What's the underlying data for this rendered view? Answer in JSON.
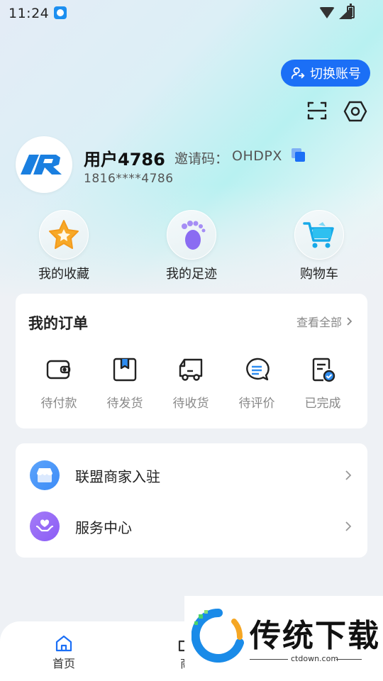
{
  "status_bar": {
    "time": "11:24"
  },
  "header": {
    "switch_account_label": "切换账号",
    "username": "用户4786",
    "invite_label": "邀请码：",
    "invite_code": "OHDPX",
    "phone": "1816****4786"
  },
  "quick_links": [
    {
      "label": "我的收藏",
      "icon": "star-icon"
    },
    {
      "label": "我的足迹",
      "icon": "footprint-icon"
    },
    {
      "label": "购物车",
      "icon": "cart-icon"
    }
  ],
  "orders": {
    "title": "我的订单",
    "view_all": "查看全部",
    "items": [
      {
        "label": "待付款",
        "icon": "wallet-icon"
      },
      {
        "label": "待发货",
        "icon": "package-icon"
      },
      {
        "label": "待收货",
        "icon": "truck-icon"
      },
      {
        "label": "待评价",
        "icon": "comment-icon"
      },
      {
        "label": "已完成",
        "icon": "completed-icon"
      }
    ]
  },
  "menu": [
    {
      "label": "联盟商家入驻",
      "icon": "store-icon",
      "color": "#3d8cf7"
    },
    {
      "label": "服务中心",
      "icon": "service-heart-icon",
      "color": "#8b5cf6"
    }
  ],
  "bottom_nav": [
    {
      "label": "首页",
      "icon": "home-icon"
    },
    {
      "label": "商",
      "icon": "shop-icon"
    }
  ],
  "watermark": {
    "title": "传统下载",
    "url": "ctdown.com"
  },
  "colors": {
    "accent": "#1b6ff6",
    "card_bg": "#ffffff",
    "page_bg": "#eef1f5"
  }
}
